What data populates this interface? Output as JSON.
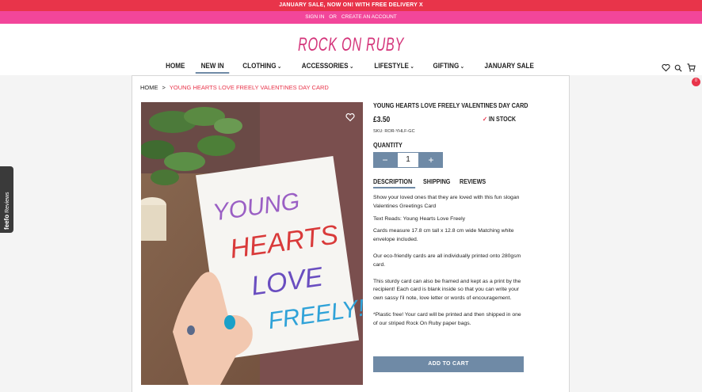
{
  "promo": {
    "text": "JANUARY SALE, NOW ON! WITH FREE DELIVERY X"
  },
  "account": {
    "sign_in": "SIGN IN",
    "or": "OR",
    "create": "CREATE AN ACCOUNT"
  },
  "logo": {
    "text": "ROCK ON RUBY",
    "color": "#d4347a"
  },
  "header_icons": {
    "wishlist": "heart-icon",
    "search": "search-icon",
    "cart": "cart-icon",
    "cart_count": "0"
  },
  "nav": {
    "home": "HOME",
    "new_in": "NEW IN",
    "clothing": "CLOTHING",
    "accessories": "ACCESSORIES",
    "lifestyle": "LIFESTYLE",
    "gifting": "GIFTING",
    "january_sale": "JANUARY SALE"
  },
  "breadcrumb": {
    "home": "HOME",
    "sep": ">",
    "current": "YOUNG HEARTS LOVE FREELY VALENTINES DAY CARD"
  },
  "card_text": {
    "line1": "YOUNG",
    "line2": "HEARTS",
    "line3": "LOVE",
    "line4": "FREELY!"
  },
  "product": {
    "title": "YOUNG HEARTS LOVE FREELY VALENTINES DAY CARD",
    "price": "£3.50",
    "stock": "IN STOCK",
    "sku": "SKU: ROR-YHLF-GC",
    "qty_label": "QUANTITY",
    "qty_minus": "−",
    "qty_value": "1",
    "qty_plus": "+"
  },
  "tabs": {
    "description": "DESCRIPTION",
    "shipping": "SHIPPING",
    "reviews": "REVIEWS"
  },
  "description": {
    "p1": "Show your loved ones that they are loved with this fun slogan Valentines Greetings Card",
    "p2": "Text Reads: Young Hearts Love Freely",
    "p3": "Cards measure 17.8 cm tall x 12.8 cm wide Matching white envelope included.",
    "p4": "Our eco-friendly cards are all individually printed onto 280gsm card.",
    "p5": "This sturdy card can also be framed and kept as a print by the recipient! Each card is blank inside so that you can write your own sassy l'il note, love letter or words of encouragement.",
    "p6": "*Plastic free! Your card will be printed and then shipped in one of our striped Rock On Ruby paper bags."
  },
  "add_to_cart": "ADD TO CART",
  "feefo": {
    "brand": "feefo",
    "label": "Reviews"
  },
  "colors": {
    "accent": "#6f8aa6",
    "pink": "#f2469a",
    "red": "#e8344a"
  }
}
